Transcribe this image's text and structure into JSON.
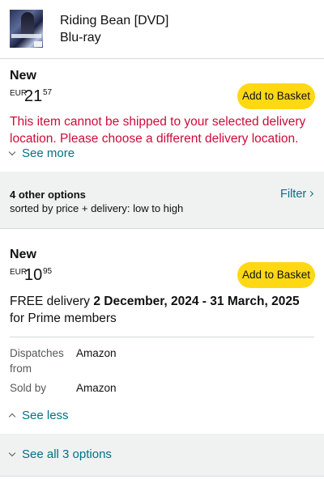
{
  "product": {
    "title": "Riding Bean [DVD]",
    "format": "Blu-ray",
    "thumbnail_icon": "dvd-cover-image"
  },
  "primary_offer": {
    "condition": "New",
    "currency": "EUR",
    "price_whole": "21",
    "price_fraction": "57",
    "add_button_label": "Add to Basket",
    "warning": "This item cannot be shipped to your selected delivery location. Please choose a different delivery location.",
    "see_more_label": "See more"
  },
  "other_options": {
    "count_label": "4 other options",
    "sort_label": "sorted by price + delivery: low to high",
    "filter_label": "Filter"
  },
  "offer_card": {
    "condition": "New",
    "currency": "EUR",
    "price_whole": "10",
    "price_fraction": "95",
    "add_button_label": "Add to Basket",
    "delivery_prefix": "FREE delivery ",
    "delivery_dates": "2 December, 2024 - 31 March, 2025",
    "delivery_suffix": " for Prime members",
    "dispatches_label": "Dispatches from",
    "dispatches_value": "Amazon",
    "sold_by_label": "Sold by",
    "sold_by_value": "Amazon",
    "see_less_label": "See less"
  },
  "see_all_label": "See all 3 options",
  "colors": {
    "accent_link": "#007185",
    "warning": "#cc0c39",
    "button_yellow": "#ffd814",
    "band_gray": "#f0f2f2"
  }
}
